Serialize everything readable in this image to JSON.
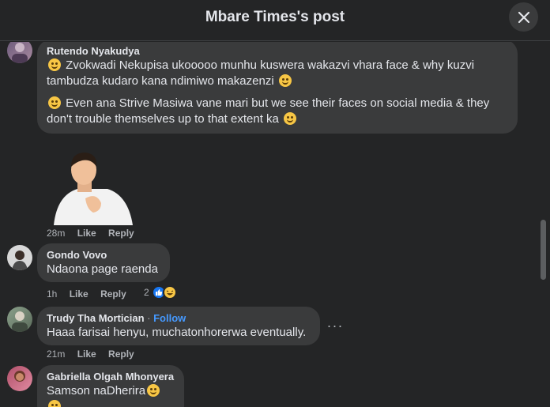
{
  "header": {
    "title": "Mbare Times's post"
  },
  "comments": [
    {
      "author": "Rutendo Nyakudya",
      "paragraph1": "Zvokwadi Nekupisa ukooooo munhu kuswera wakazvi vhara face & why kuzvi tambudza kudaro kana ndimiwo makazenzi",
      "paragraph2": "Even ana Strive Masiwa vane mari but we see their faces on social media & they don't trouble themselves up to that extent ka",
      "time": "28m",
      "like": "Like",
      "reply": "Reply"
    },
    {
      "author": "Gondo Vovo",
      "text": "Ndaona page raenda",
      "time": "1h",
      "like": "Like",
      "reply": "Reply",
      "reaction_count": "2"
    },
    {
      "author": "Trudy Tha Mortician",
      "follow": "Follow",
      "separator": "·",
      "text": "Haaa farisai henyu, muchatonhorerwa eventually.",
      "time": "21m",
      "like": "Like",
      "reply": "Reply",
      "more": "···"
    },
    {
      "author": "Gabriella Olgah Mhonyera",
      "text": "Samson naDherira"
    }
  ],
  "icons": {
    "close": "close-icon",
    "like_reaction": "like-reaction-icon",
    "haha_reaction": "haha-reaction-icon"
  },
  "colors": {
    "background": "#242526",
    "bubble": "#3a3b3c",
    "accent": "#4599ff",
    "like_blue": "#1877f2"
  }
}
